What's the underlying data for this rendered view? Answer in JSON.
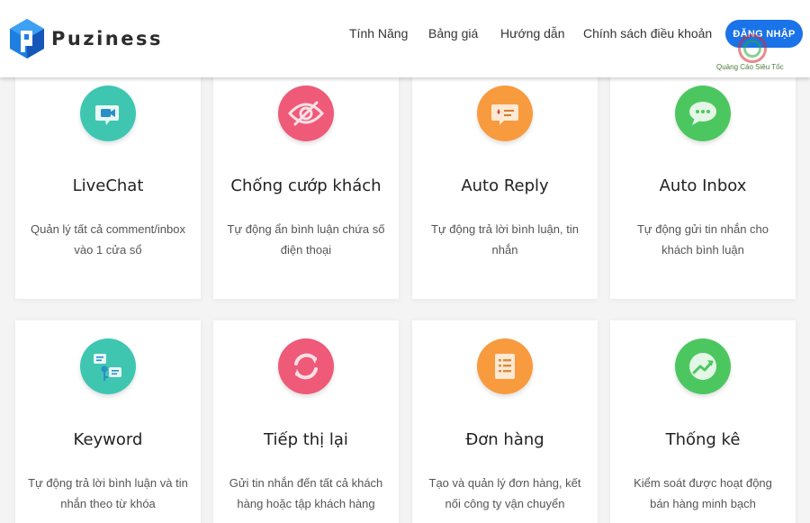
{
  "brand": {
    "name": "Puziness"
  },
  "nav": {
    "items": [
      "Tính Năng",
      "Bảng giá",
      "Hướng dẫn",
      "Chính sách điều khoản"
    ],
    "login_label": "ĐĂNG NHẬP"
  },
  "watermark": {
    "text": "Quảng Cáo Siêu Tốc"
  },
  "features": [
    {
      "title": "LiveChat",
      "desc": "Quản lý tất cả comment/inbox vào 1 cửa sổ",
      "color": "#3fc6b1",
      "icon": "video-chat-icon"
    },
    {
      "title": "Chống cướp khách",
      "desc": "Tự động ẩn bình luận chứa số điện thoại",
      "color": "#ee5a78",
      "icon": "eye-off-icon"
    },
    {
      "title": "Auto Reply",
      "desc": "Tự động trả lời bình luận, tin nhắn",
      "color": "#f89a3e",
      "icon": "auto-reply-icon"
    },
    {
      "title": "Auto Inbox",
      "desc": "Tự động gửi tin nhắn cho khách bình luận",
      "color": "#4cc760",
      "icon": "chat-bubble-icon"
    },
    {
      "title": "Keyword",
      "desc": "Tự động trả lời bình luận và tin nhắn theo từ khóa",
      "color": "#3fc6b1",
      "icon": "keyword-icon"
    },
    {
      "title": "Tiếp thị lại",
      "desc": "Gửi tin nhắn đến tất cả khách hàng hoặc tập khách hàng",
      "color": "#ee5a78",
      "icon": "refresh-icon"
    },
    {
      "title": "Đơn hàng",
      "desc": "Tạo và quản lý đơn hàng, kết nối công ty vận chuyển",
      "color": "#f89a3e",
      "icon": "order-list-icon"
    },
    {
      "title": "Thống kê",
      "desc": "Kiểm soát được hoạt động bán hàng minh bạch",
      "color": "#4cc760",
      "icon": "trending-chart-icon"
    }
  ]
}
